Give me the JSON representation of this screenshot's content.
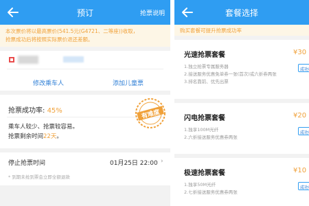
{
  "left": {
    "nav": {
      "title": "预订",
      "right_link": "抢票说明"
    },
    "notice": [
      "本次票价将以最高票价(541.5元(G4721、二等座))收取，",
      "抢票成功后将按照实际票价退还差额。"
    ],
    "passenger": {
      "edit_label": "修改乘车人",
      "add_child_label": "添加儿童票"
    },
    "success_rate": {
      "label": "抢票成功率:",
      "value": "45%",
      "line1": "乘车人较少、抢票较容易。",
      "line2_prefix": "抢票剩余时间",
      "line2_days": "22天",
      "line2_suffix": "。",
      "stamp_text": "有难度"
    },
    "stop_time": {
      "label": "停止抢票时间",
      "value": "01月25日 22:00",
      "note": "* 到期未抢到票会立即全额退款"
    }
  },
  "right": {
    "nav": {
      "title": "套餐选择"
    },
    "hint": "购买套餐可提升抢票成功率",
    "packages": [
      {
        "title": "光速抢票套餐",
        "price": "¥30",
        "badge": "成功率",
        "lines": [
          "1.独立抢票专属服务器",
          "2.接送服务优惠免单券一张(首次)或六折券两张",
          "3.排名靠前、优先出票"
        ]
      },
      {
        "title": "闪电抢票套餐",
        "price": "¥20",
        "badge": "成功率",
        "lines": [
          "1.独享100M光纤",
          "2.六折接送服务优惠券两张"
        ]
      },
      {
        "title": "极速抢票套餐",
        "price": "¥10",
        "badge": "成功率",
        "lines": [
          "1.独享50M光纤",
          "2.七折接送服务优惠券两张"
        ]
      }
    ]
  },
  "colors": {
    "nav_blue": "#2f9df2",
    "accent_orange": "#f0a13a",
    "link_blue": "#2f7fd6"
  }
}
